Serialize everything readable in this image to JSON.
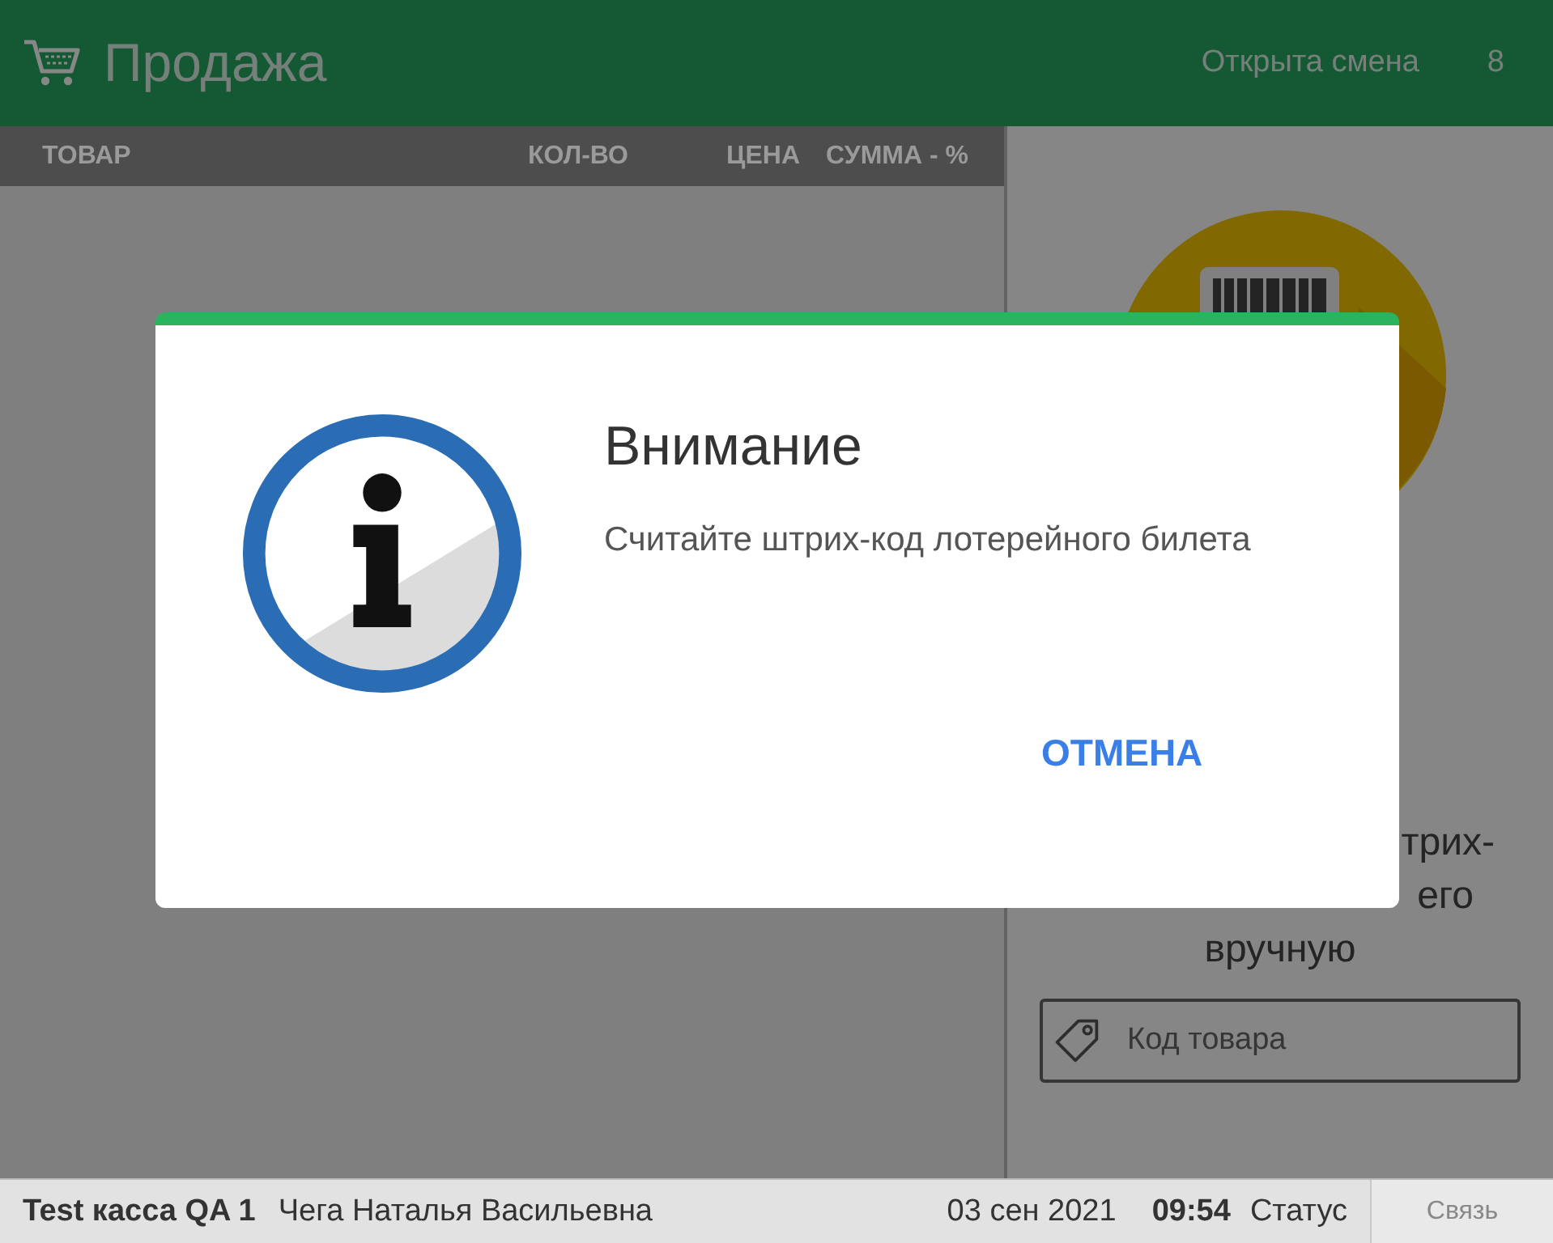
{
  "header": {
    "title": "Продажа",
    "shift_status": "Открыта смена",
    "shift_number": "8"
  },
  "table": {
    "columns": [
      "ТОВАР",
      "КОЛ-ВО",
      "ЦЕНА",
      "СУММА - %"
    ]
  },
  "scan_panel": {
    "hint_lines": [
      "трих-",
      "его",
      "вручную"
    ],
    "code_field": {
      "placeholder": "Код товара"
    }
  },
  "dialog": {
    "title": "Внимание",
    "message": "Считайте штрих-код лотерейного билета",
    "buttons": [
      "ОТМЕНА"
    ]
  },
  "status_bar": {
    "register": "Test касса QA 1",
    "cashier": "Чега Наталья Васильевна",
    "date": "03 сен 2021",
    "time": "09:54",
    "status": "Статус",
    "connection_button": "Связь"
  }
}
